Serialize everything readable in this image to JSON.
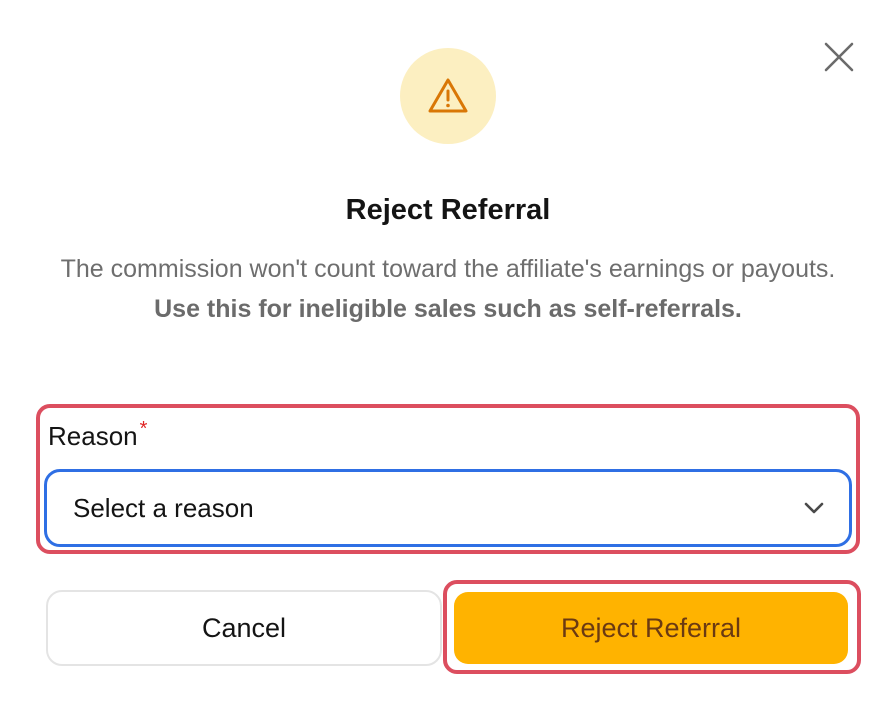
{
  "dialog": {
    "title": "Reject Referral",
    "description_plain": "The commission won't count toward the affiliate's earnings or payouts. ",
    "description_bold": "Use this for ineligible sales such as self-referrals.",
    "close_icon": "close-icon",
    "warning_icon": "warning-triangle-icon"
  },
  "reason_field": {
    "label": "Reason",
    "required_marker": "*",
    "selected_value": "Select a reason",
    "dropdown_icon": "chevron-down-icon"
  },
  "actions": {
    "cancel_label": "Cancel",
    "reject_label": "Reject Referral"
  },
  "colors": {
    "accent": "#ffb300",
    "accent_text": "#6b3a12",
    "warning_bg": "#fcefc1",
    "warning_icon": "#d97706",
    "focus_border": "#2f6fe4",
    "highlight_border": "#dc4e5f",
    "required": "#e02424"
  }
}
